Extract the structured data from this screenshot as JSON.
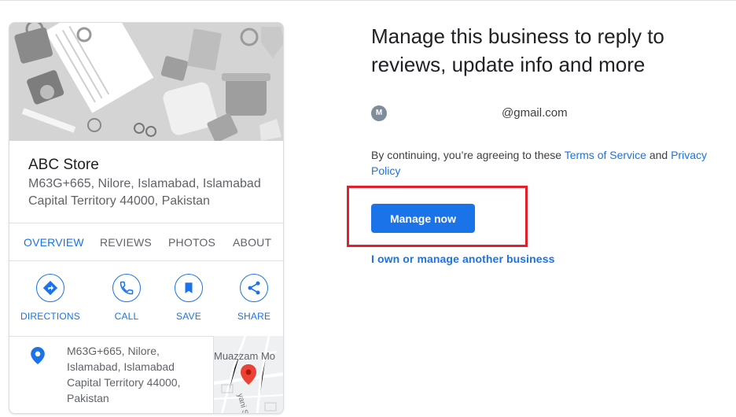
{
  "card": {
    "name": "ABC Store",
    "address": "M63G+665, Nilore, Islamabad, Islamabad Capital Territory 44000, Pakistan",
    "tabs": [
      {
        "label": "OVERVIEW",
        "active": true
      },
      {
        "label": "REVIEWS",
        "active": false
      },
      {
        "label": "PHOTOS",
        "active": false
      },
      {
        "label": "ABOUT",
        "active": false
      }
    ],
    "actions": [
      {
        "label": "DIRECTIONS",
        "icon": "directions-icon"
      },
      {
        "label": "CALL",
        "icon": "phone-icon"
      },
      {
        "label": "SAVE",
        "icon": "bookmark-icon"
      },
      {
        "label": "SHARE",
        "icon": "share-icon"
      }
    ],
    "location_address": "M63G+665, Nilore, Islamabad, Islamabad Capital Territory 44000, Pakistan",
    "map_label": "Muazzam Mo",
    "map_street": "yani St"
  },
  "claim": {
    "headline": "Manage this business to reply to reviews, update info and more",
    "avatar_initial": "M",
    "email": "@gmail.com",
    "terms_prefix": "By continuing, you’re agreeing to these ",
    "terms_link": "Terms of Service",
    "terms_and": " and ",
    "privacy_link": "Privacy Policy",
    "manage_button": "Manage now",
    "other_business_link": "I own or manage another business"
  },
  "colors": {
    "accent": "#1a73e8",
    "highlight": "#e0202a",
    "pin": "#1a73e8",
    "map_pin": "#ea4335"
  }
}
